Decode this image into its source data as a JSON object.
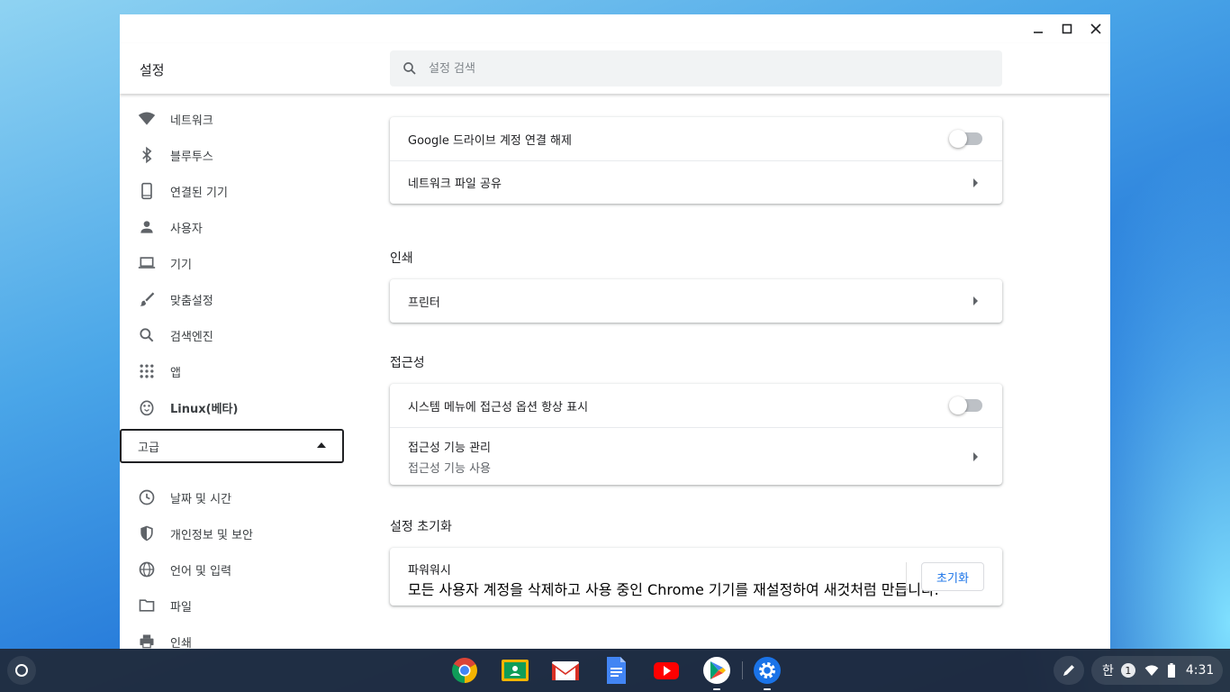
{
  "window": {
    "title": "설정",
    "search_placeholder": "설정 검색"
  },
  "sidebar": {
    "items": [
      {
        "label": "네트워크",
        "icon": "wifi-icon"
      },
      {
        "label": "블루투스",
        "icon": "bluetooth-icon"
      },
      {
        "label": "연결된 기기",
        "icon": "phone-icon"
      },
      {
        "label": "사용자",
        "icon": "person-icon"
      },
      {
        "label": "기기",
        "icon": "laptop-icon"
      },
      {
        "label": "맞춤설정",
        "icon": "brush-icon"
      },
      {
        "label": "검색엔진",
        "icon": "search-icon"
      },
      {
        "label": "앱",
        "icon": "apps-grid-icon"
      },
      {
        "label": "Linux(베타)",
        "icon": "penguin-icon"
      }
    ],
    "advanced_label": "고급",
    "advanced_items": [
      {
        "label": "날짜 및 시간",
        "icon": "clock-icon"
      },
      {
        "label": "개인정보 및 보안",
        "icon": "shield-icon"
      },
      {
        "label": "언어 및 입력",
        "icon": "globe-icon"
      },
      {
        "label": "파일",
        "icon": "folder-icon"
      },
      {
        "label": "인쇄",
        "icon": "printer-icon"
      }
    ]
  },
  "main": {
    "files_card": {
      "rows": [
        {
          "label": "Google 드라이브 계정 연결 해제",
          "control": "toggle",
          "on": false
        },
        {
          "label": "네트워크 파일 공유",
          "control": "chevron"
        }
      ]
    },
    "printing": {
      "title": "인쇄",
      "rows": [
        {
          "label": "프린터",
          "control": "chevron"
        }
      ]
    },
    "accessibility": {
      "title": "접근성",
      "rows": [
        {
          "label": "시스템 메뉴에 접근성 옵션 항상 표시",
          "control": "toggle",
          "on": false
        },
        {
          "label": "접근성 기능 관리",
          "sublabel": "접근성 기능 사용",
          "control": "chevron"
        }
      ]
    },
    "reset": {
      "title": "설정 초기화",
      "powerwash_label": "파워워시",
      "powerwash_desc": "모든 사용자 계정을 삭제하고 사용 중인 Chrome 기기를 재설정하여 새것처럼 만듭니다.",
      "button_label": "초기화"
    }
  },
  "shelf": {
    "apps": [
      {
        "name": "chrome-icon"
      },
      {
        "name": "classroom-icon"
      },
      {
        "name": "gmail-icon"
      },
      {
        "name": "docs-icon"
      },
      {
        "name": "youtube-icon"
      },
      {
        "name": "play-store-icon"
      },
      {
        "name": "settings-icon"
      }
    ],
    "ime": "한",
    "notification_count": "1",
    "time": "4:31"
  },
  "colors": {
    "accent": "#1a73e8",
    "text_primary": "#202124",
    "text_secondary": "#5f6368",
    "shelf_bg": "#202837"
  }
}
